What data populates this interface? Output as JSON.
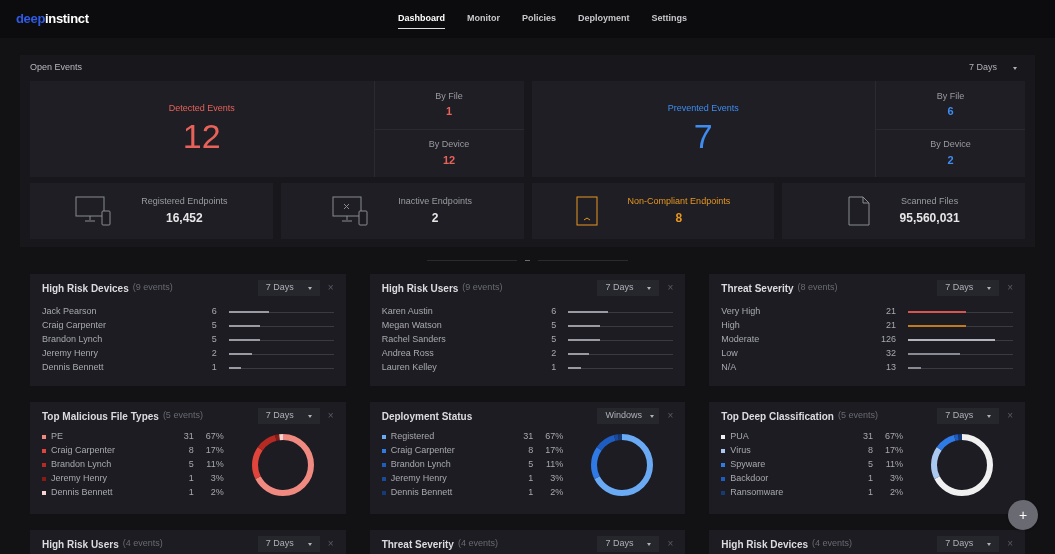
{
  "brand": {
    "part1": "deep",
    "part2": "instinct"
  },
  "nav": [
    {
      "label": "Dashboard",
      "selected": true
    },
    {
      "label": "Monitor",
      "selected": false
    },
    {
      "label": "Policies",
      "selected": false
    },
    {
      "label": "Deployment",
      "selected": false
    },
    {
      "label": "Settings",
      "selected": false
    }
  ],
  "open_events": {
    "title": "Open Events",
    "range": "7 Days",
    "summaries": [
      {
        "label": "Detected Events",
        "value": "12",
        "color": "#e8625a",
        "by_file_label": "By File",
        "by_file": "1",
        "by_device_label": "By Device",
        "by_device": "12"
      },
      {
        "label": "Prevented Events",
        "value": "7",
        "color": "#3f8cf0",
        "by_file_label": "By File",
        "by_file": "6",
        "by_device_label": "By Device",
        "by_device": "2"
      }
    ],
    "stats": [
      {
        "kind": "devices",
        "label": "Registered Endpoints",
        "value": "16,452",
        "color": "#e6e6e6"
      },
      {
        "kind": "inactive",
        "label": "Inactive Endpoints",
        "value": "2",
        "color": "#e6e6e6"
      },
      {
        "kind": "tablet",
        "label": "Non-Compliant Endpoints",
        "value": "8",
        "color": "#e8961e"
      },
      {
        "kind": "file",
        "label": "Scanned Files",
        "value": "95,560,031",
        "color": "#e6e6e6"
      }
    ]
  },
  "widgets": [
    {
      "kind": "bars",
      "title": "High Risk Devices",
      "subtitle": "(9 events)",
      "range": "7 Days",
      "close": "×",
      "rows": [
        {
          "name": "Jack Pearson",
          "count": "6",
          "level": 0.38,
          "color": "#9a9aa2"
        },
        {
          "name": "Craig Carpenter",
          "count": "5",
          "level": 0.3,
          "color": "#9a9aa2"
        },
        {
          "name": "Brandon Lynch",
          "count": "5",
          "level": 0.3,
          "color": "#9a9aa2"
        },
        {
          "name": "Jeremy Henry",
          "count": "2",
          "level": 0.22,
          "color": "#9a9aa2"
        },
        {
          "name": "Dennis Bennett",
          "count": "1",
          "level": 0.12,
          "color": "#9a9aa2"
        }
      ]
    },
    {
      "kind": "bars",
      "title": "High Risk Users",
      "subtitle": "(9 events)",
      "range": "7 Days",
      "close": "×",
      "rows": [
        {
          "name": "Karen Austin",
          "count": "6",
          "level": 0.38,
          "color": "#9a9aa2"
        },
        {
          "name": "Megan Watson",
          "count": "5",
          "level": 0.3,
          "color": "#9a9aa2"
        },
        {
          "name": "Rachel Sanders",
          "count": "5",
          "level": 0.3,
          "color": "#9a9aa2"
        },
        {
          "name": "Andrea Ross",
          "count": "2",
          "level": 0.2,
          "color": "#9a9aa2"
        },
        {
          "name": "Lauren Kelley",
          "count": "1",
          "level": 0.12,
          "color": "#9a9aa2"
        }
      ]
    },
    {
      "kind": "bars",
      "title": "Threat Severity",
      "subtitle": "(8 events)",
      "range": "7 Days",
      "close": "×",
      "rows": [
        {
          "name": "Very High",
          "count": "21",
          "level": 0.55,
          "color": "#d9534f"
        },
        {
          "name": "High",
          "count": "21",
          "level": 0.55,
          "color": "#c27a1e"
        },
        {
          "name": "Moderate",
          "count": "126",
          "level": 0.83,
          "color": "#b4b4bc"
        },
        {
          "name": "Low",
          "count": "32",
          "level": 0.5,
          "color": "#8a8a92"
        },
        {
          "name": "N/A",
          "count": "13",
          "level": 0.12,
          "color": "#8a8a92"
        }
      ]
    },
    {
      "kind": "donut",
      "title": "Top Malicious File Types",
      "subtitle": "(5 events)",
      "range": "7 Days",
      "close": "×",
      "rows": [
        {
          "name": "PE",
          "count": "31",
          "percent": "67%",
          "color": "#f08a80"
        },
        {
          "name": "Craig Carpenter",
          "count": "8",
          "percent": "17%",
          "color": "#e0443a"
        },
        {
          "name": "Brandon Lynch",
          "count": "5",
          "percent": "11%",
          "color": "#b52a22"
        },
        {
          "name": "Jeremy Henry",
          "count": "1",
          "percent": "3%",
          "color": "#8a1a14"
        },
        {
          "name": "Dennis Bennett",
          "count": "1",
          "percent": "2%",
          "color": "#f4d4d0"
        }
      ]
    },
    {
      "kind": "donut",
      "title": "Deployment Status",
      "range": "Windows",
      "close": "×",
      "rows": [
        {
          "name": "Registered",
          "count": "31",
          "percent": "67%",
          "color": "#6aaaf5"
        },
        {
          "name": "Craig Carpenter",
          "count": "8",
          "percent": "17%",
          "color": "#2f7ae5"
        },
        {
          "name": "Brandon Lynch",
          "count": "5",
          "percent": "11%",
          "color": "#1f5cc0"
        },
        {
          "name": "Jeremy Henry",
          "count": "1",
          "percent": "3%",
          "color": "#1a4a9a"
        },
        {
          "name": "Dennis Bennett",
          "count": "1",
          "percent": "2%",
          "color": "#153a78"
        }
      ]
    },
    {
      "kind": "donut",
      "title": "Top Deep Classification",
      "subtitle": "(5 events)",
      "range": "7 Days",
      "close": "×",
      "rows": [
        {
          "name": "PUA",
          "count": "31",
          "percent": "67%",
          "color": "#f0f0f0"
        },
        {
          "name": "Virus",
          "count": "8",
          "percent": "17%",
          "color": "#aac8f0"
        },
        {
          "name": "Spyware",
          "count": "5",
          "percent": "11%",
          "color": "#2f7ae5"
        },
        {
          "name": "Backdoor",
          "count": "1",
          "percent": "3%",
          "color": "#1f5cc0"
        },
        {
          "name": "Ransomware",
          "count": "1",
          "percent": "2%",
          "color": "#153a78"
        }
      ]
    },
    {
      "kind": "cut",
      "title": "High Risk Users",
      "subtitle": "(4 events)",
      "range": "7 Days",
      "close": "×"
    },
    {
      "kind": "cut",
      "title": "Threat Severity",
      "subtitle": "(4 events)",
      "range": "7 Days",
      "close": "×"
    },
    {
      "kind": "cut",
      "title": "High Risk Devices",
      "subtitle": "(4 events)",
      "range": "7 Days",
      "close": "×"
    }
  ],
  "fab": "+"
}
